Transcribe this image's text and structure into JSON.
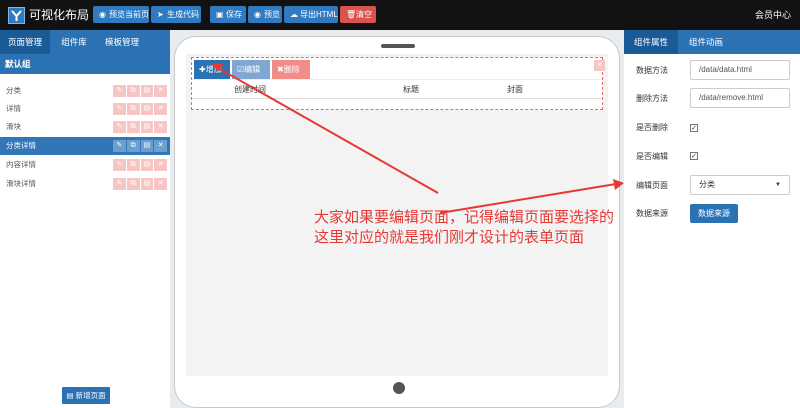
{
  "app": {
    "title": "可视化布局",
    "member_label": "会员中心"
  },
  "toolbar": {
    "preview_current": "预览当前页",
    "generate_code": "生成代码",
    "save": "保存",
    "preview": "预览",
    "export_html": "导出HTML",
    "clear": "清空"
  },
  "left_panel": {
    "tabs": [
      "页面管理",
      "组件库",
      "模板管理"
    ],
    "active_tab": "页面管理",
    "group_name": "默认组",
    "pages": [
      "分类",
      "详情",
      "滑块",
      "分类详情",
      "内容详情",
      "滑块详情"
    ],
    "selected_page": "分类详情",
    "row_actions": [
      "✎",
      "⧉",
      "▤",
      "✕"
    ],
    "new_page_label": "新增页面"
  },
  "canvas": {
    "buttons": {
      "add": "增加",
      "edit": "编辑",
      "delete": "删除"
    },
    "columns": [
      "创建时间",
      "标题",
      "封面"
    ]
  },
  "right_panel": {
    "tabs": [
      "组件属性",
      "组件动画"
    ],
    "active_tab": "组件属性",
    "fields": {
      "data_method": {
        "label": "数据方法",
        "value": "/data/data.html"
      },
      "delete_method": {
        "label": "删除方法",
        "value": "/data/remove.html"
      },
      "can_delete": {
        "label": "是否删除",
        "checked": true
      },
      "can_edit": {
        "label": "是否编辑",
        "checked": true
      },
      "edit_page": {
        "label": "编辑页面",
        "value": "分类"
      },
      "data_source": {
        "label": "数据来源",
        "button": "数据来源"
      }
    }
  },
  "annotation": {
    "line1": "大家如果要编辑页面，记得编辑页面要选择的",
    "line2": "这里对应的就是我们刚才设计的表单页面",
    "color": "#e53935"
  },
  "colors": {
    "primary": "#2b72b5",
    "danger": "#d9534f",
    "topbar": "#121212"
  }
}
